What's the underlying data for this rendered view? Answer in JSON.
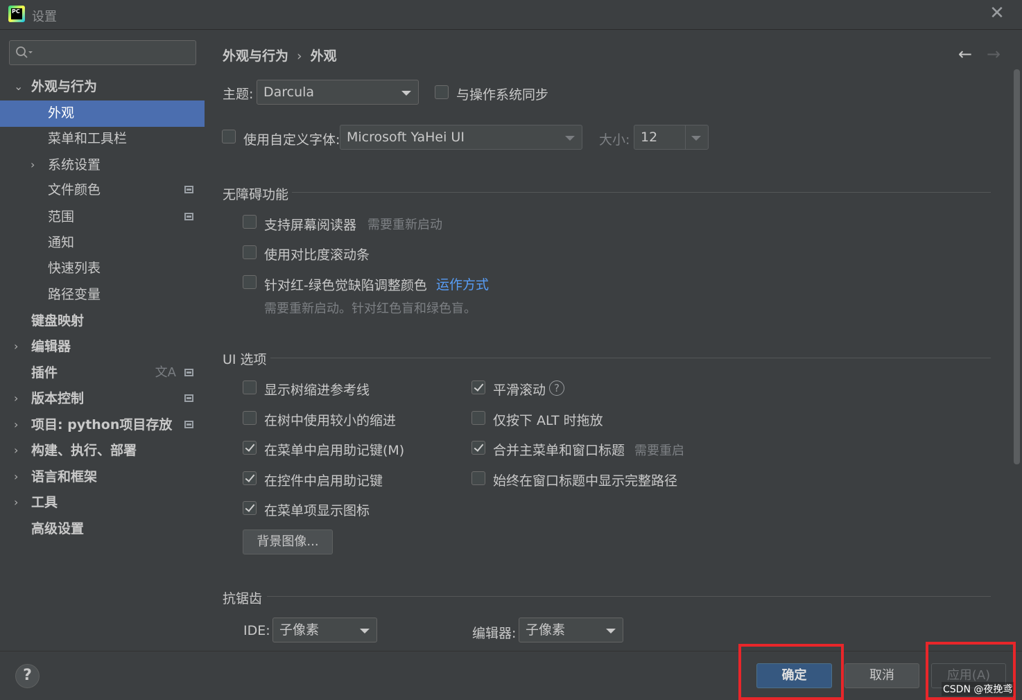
{
  "window": {
    "title": "设置",
    "close_symbol": "✕",
    "app_icon_text": "PC"
  },
  "sidebar": {
    "search_placeholder": "",
    "items": [
      {
        "label": "外观与行为",
        "expanded": true
      },
      {
        "label": "外观",
        "selected": true
      },
      {
        "label": "菜单和工具栏"
      },
      {
        "label": "系统设置",
        "expandable": true
      },
      {
        "label": "文件颜色"
      },
      {
        "label": "范围"
      },
      {
        "label": "通知"
      },
      {
        "label": "快速列表"
      },
      {
        "label": "路径变量"
      },
      {
        "label": "键盘映射"
      },
      {
        "label": "编辑器",
        "expandable": true
      },
      {
        "label": "插件"
      },
      {
        "label": "版本控制",
        "expandable": true
      },
      {
        "label": "项目: python项目存放",
        "expandable": true
      },
      {
        "label": "构建、执行、部署",
        "expandable": true
      },
      {
        "label": "语言和框架",
        "expandable": true
      },
      {
        "label": "工具",
        "expandable": true
      },
      {
        "label": "高级设置"
      }
    ]
  },
  "breadcrumb": {
    "parent": "外观与行为",
    "separator": "›",
    "current": "外观"
  },
  "nav": {
    "back": "←",
    "forward": "→"
  },
  "theme": {
    "label": "主题:",
    "value": "Darcula",
    "sync_label": "与操作系统同步",
    "sync_checked": false
  },
  "font": {
    "custom_label": "使用自定义字体:",
    "custom_checked": false,
    "value": "Microsoft YaHei UI",
    "size_label": "大小:",
    "size_value": "12"
  },
  "accessibility": {
    "title": "无障碍功能",
    "screen_reader": {
      "label": "支持屏幕阅读器",
      "hint": "需要重新启动",
      "checked": false
    },
    "contrast_scrollbars": {
      "label": "使用对比度滚动条",
      "checked": false
    },
    "color_deficiency": {
      "label": "针对红-绿色觉缺陷调整颜色",
      "link": "运作方式",
      "note": "需要重新启动。针对红色盲和绿色盲。",
      "checked": false
    }
  },
  "ui_options": {
    "title": "UI 选项",
    "left": [
      {
        "label": "显示树缩进参考线",
        "checked": false
      },
      {
        "label": "在树中使用较小的缩进",
        "checked": false
      },
      {
        "label": "在菜单中启用助记键(M)",
        "checked": true
      },
      {
        "label": "在控件中启用助记键",
        "checked": true
      },
      {
        "label": "在菜单项显示图标",
        "checked": true
      }
    ],
    "right": [
      {
        "label": "平滑滚动",
        "checked": true,
        "help": "?"
      },
      {
        "label": "仅按下 ALT 时拖放",
        "checked": false
      },
      {
        "label": "合并主菜单和窗口标题",
        "checked": true,
        "hint": "需要重启"
      },
      {
        "label": "始终在窗口标题中显示完整路径",
        "checked": false
      }
    ],
    "background_button": "背景图像..."
  },
  "antialiasing": {
    "title": "抗锯齿",
    "ide_label": "IDE:",
    "ide_value": "子像素",
    "editor_label": "编辑器:",
    "editor_value": "子像素"
  },
  "footer": {
    "help": "?",
    "ok": "确定",
    "cancel": "取消",
    "apply": "应用(A)"
  },
  "watermark": "CSDN @夜挽鸢",
  "colors": {
    "selection": "#4b6eaf",
    "link": "#589df6",
    "highlight_box": "#e8262a",
    "ok_button": "#365880"
  }
}
